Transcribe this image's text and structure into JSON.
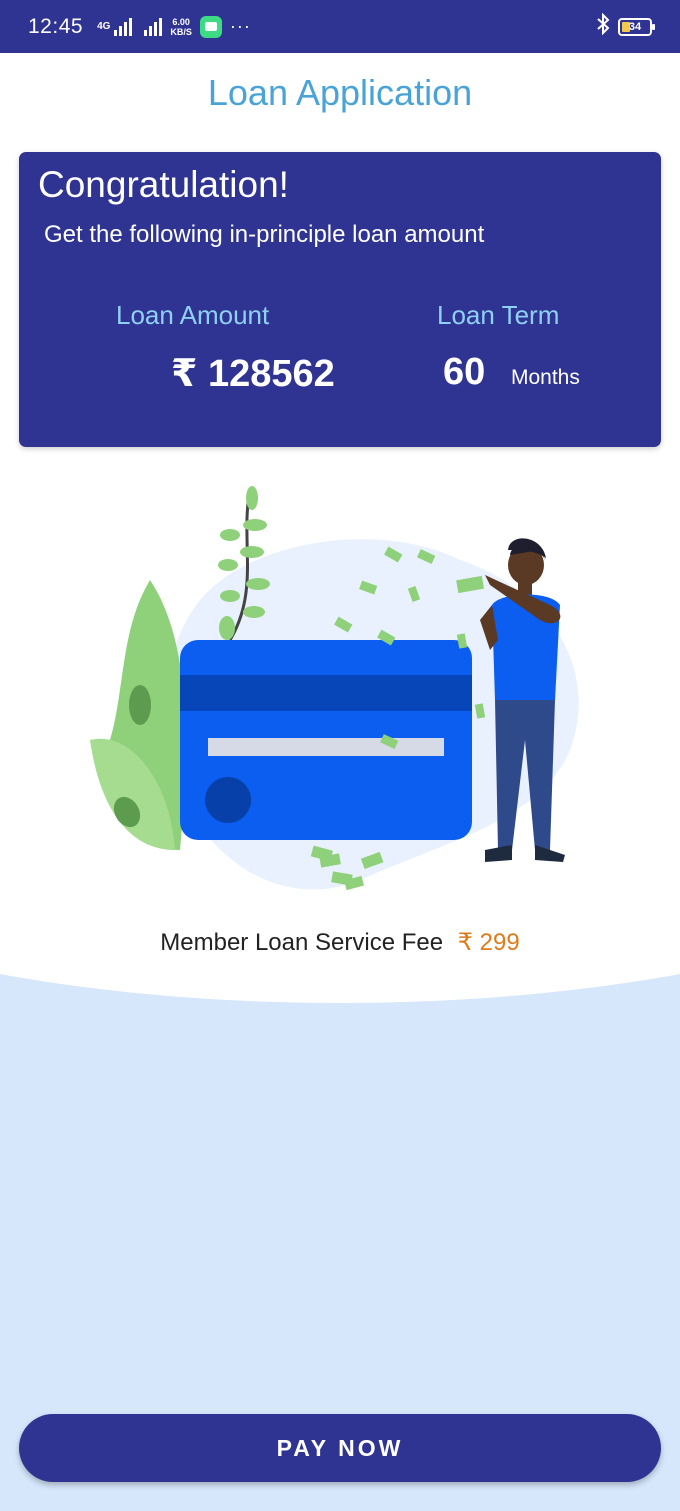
{
  "status_bar": {
    "time": "12:45",
    "network": "4G",
    "speed_value": "6.00",
    "speed_unit": "KB/S",
    "more": "···",
    "battery": "34"
  },
  "page": {
    "title": "Loan Application"
  },
  "summary": {
    "heading": "Congratulation!",
    "subtitle": "Get the following in-principle loan amount",
    "amount_label": "Loan Amount",
    "amount_value": "₹ 128562",
    "term_label": "Loan Term",
    "term_value": "60",
    "term_unit": "Months"
  },
  "fee": {
    "label": "Member Loan Service Fee",
    "value": "₹ 299"
  },
  "actions": {
    "pay_now": "PAY NOW"
  },
  "colors": {
    "primary": "#2f3492",
    "title": "#4aa3d8",
    "label_accent": "#8fd0f5",
    "fee_accent": "#e07b1a",
    "background": "#d6e6fb"
  }
}
